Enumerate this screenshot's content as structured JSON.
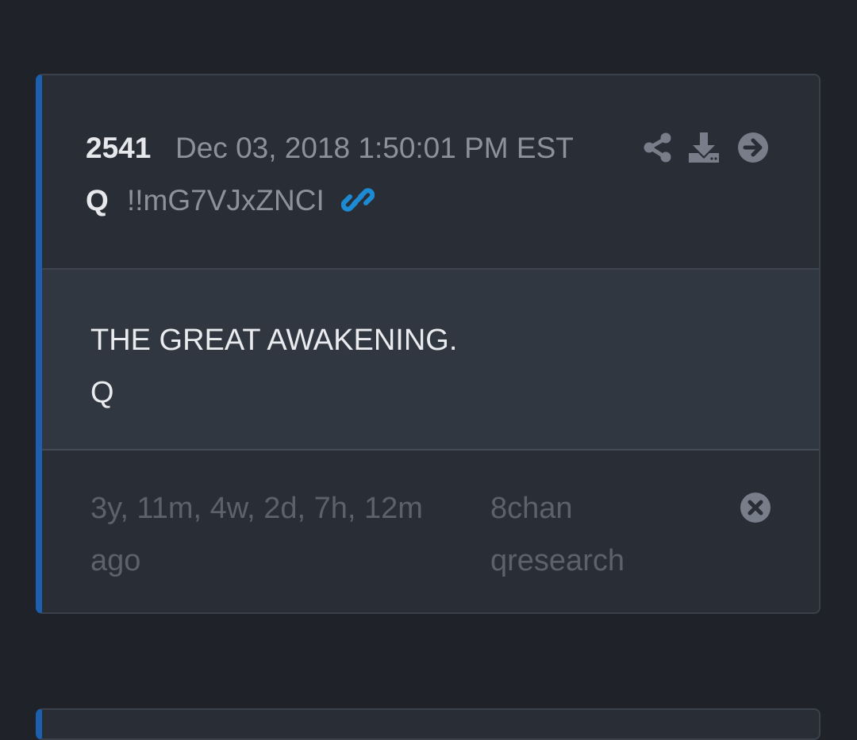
{
  "post": {
    "number": "2541",
    "date": "Dec 03, 2018 1:50:01 PM EST",
    "author": "Q",
    "tripcode": "!!mG7VJxZNCI",
    "body_lines": [
      "THE GREAT AWAKENING.",
      "Q"
    ],
    "elapsed_line1": "3y, 11m, 4w, 2d, 7h, 12m",
    "elapsed_line2": "ago",
    "board_line1": "8chan",
    "board_line2": "qresearch"
  },
  "icons": {
    "link": "link-icon",
    "share": "share-icon",
    "download": "download-icon",
    "next": "arrow-circle-right-icon",
    "close": "close-circle-icon"
  },
  "colors": {
    "background": "#1f2229",
    "card": "#292d35",
    "body": "#313741",
    "accent": "#1b5fae",
    "link": "#1d8ad4",
    "muted_icon": "#787e89"
  }
}
